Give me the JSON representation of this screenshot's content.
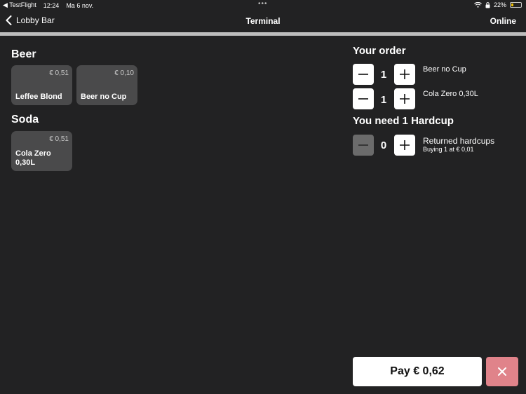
{
  "status_bar": {
    "back_app": "◀ TestFlight",
    "time": "12:24",
    "date": "Ma 6 nov.",
    "dots": "•••",
    "battery": "22%"
  },
  "nav": {
    "back_label": "Lobby Bar",
    "title": "Terminal",
    "status": "Online"
  },
  "categories": [
    {
      "title": "Beer",
      "products": [
        {
          "name": "Leffee Blond",
          "price": "€ 0,51"
        },
        {
          "name": "Beer no Cup",
          "price": "€ 0,10"
        }
      ]
    },
    {
      "title": "Soda",
      "products": [
        {
          "name": "Cola Zero\n0,30L",
          "price": "€ 0,51"
        }
      ]
    }
  ],
  "order": {
    "title": "Your order",
    "lines": [
      {
        "qty": "1",
        "name": "Beer no Cup"
      },
      {
        "qty": "1",
        "name": "Cola Zero 0,30L"
      }
    ]
  },
  "hardcup": {
    "title": "You need 1 Hardcup",
    "qty": "0",
    "name": "Returned hardcups",
    "sub": "Buying 1 at € 0,01"
  },
  "actions": {
    "pay_label": "Pay € 0,62"
  },
  "colors": {
    "background": "#222223",
    "tile": "#4a4a4b",
    "cancel": "#e0838a",
    "battery_fill": "#f2c200"
  }
}
